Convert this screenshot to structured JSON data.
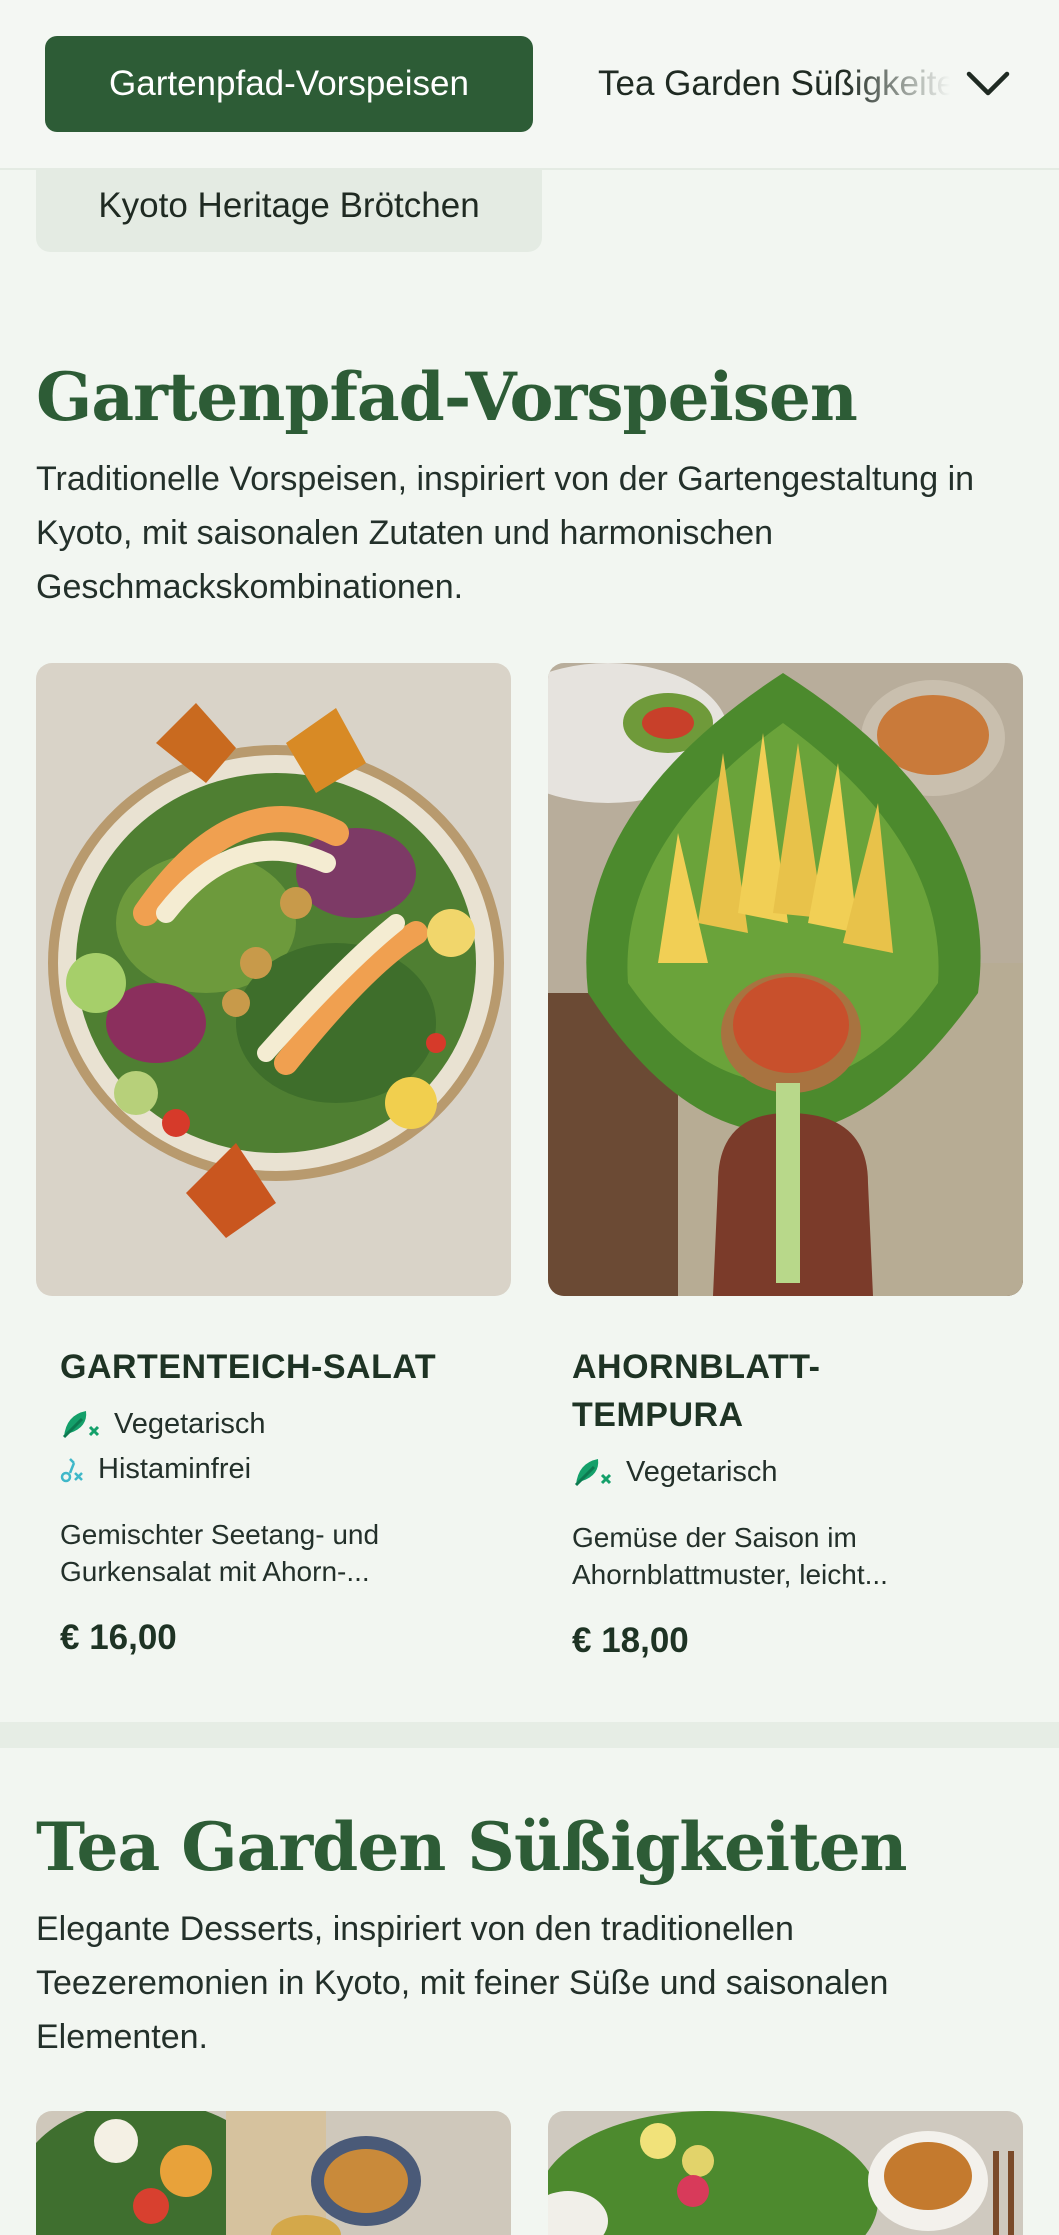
{
  "nav": {
    "active_tab": "Gartenpfad-Vorspeisen",
    "next_tab": "Tea Garden Süßigkeiten",
    "secondary_tab": "Kyoto Heritage Brötchen",
    "expand_icon": "chevron-down-icon"
  },
  "sections": [
    {
      "title": "Gartenpfad-Vorspeisen",
      "description": "Traditionelle Vorspeisen, inspiriert von der Gartengestaltung in Kyoto, mit saisonalen Zutaten und harmonischen Geschmackskombinationen.",
      "items": [
        {
          "name": "GARTENTEICH-SALAT",
          "tags": [
            "Vegetarisch",
            "Histaminfrei"
          ],
          "description": "Gemischter Seetang- und Gurkensalat mit Ahorn-...",
          "price": "€ 16,00"
        },
        {
          "name": "AHORNBLATT-TEMPURA",
          "tags": [
            "Vegetarisch"
          ],
          "description": "Gemüse der Saison im Ahornblattmuster, leicht...",
          "price": "€ 18,00"
        }
      ]
    },
    {
      "title": "Tea Garden Süßigkeiten",
      "description": "Elegante Desserts, inspiriert von den traditionellen Teezeremonien in Kyoto, mit feiner Süße und saisonalen Elementen."
    }
  ],
  "colors": {
    "accent": "#2d5c36",
    "background": "#f2f6f1",
    "tag_vegetarian": "#14a06a",
    "tag_histamine": "#3fb8c9"
  }
}
